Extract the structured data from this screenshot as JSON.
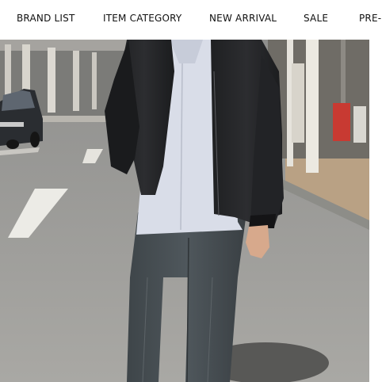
{
  "nav": {
    "items": [
      {
        "label": "BRAND LIST"
      },
      {
        "label": "ITEM CATEGORY"
      },
      {
        "label": "NEW ARRIVAL"
      },
      {
        "label": "SALE"
      },
      {
        "label": "PRE-ORDER"
      }
    ]
  },
  "colors": {
    "text": "#111111",
    "background": "#ffffff"
  }
}
